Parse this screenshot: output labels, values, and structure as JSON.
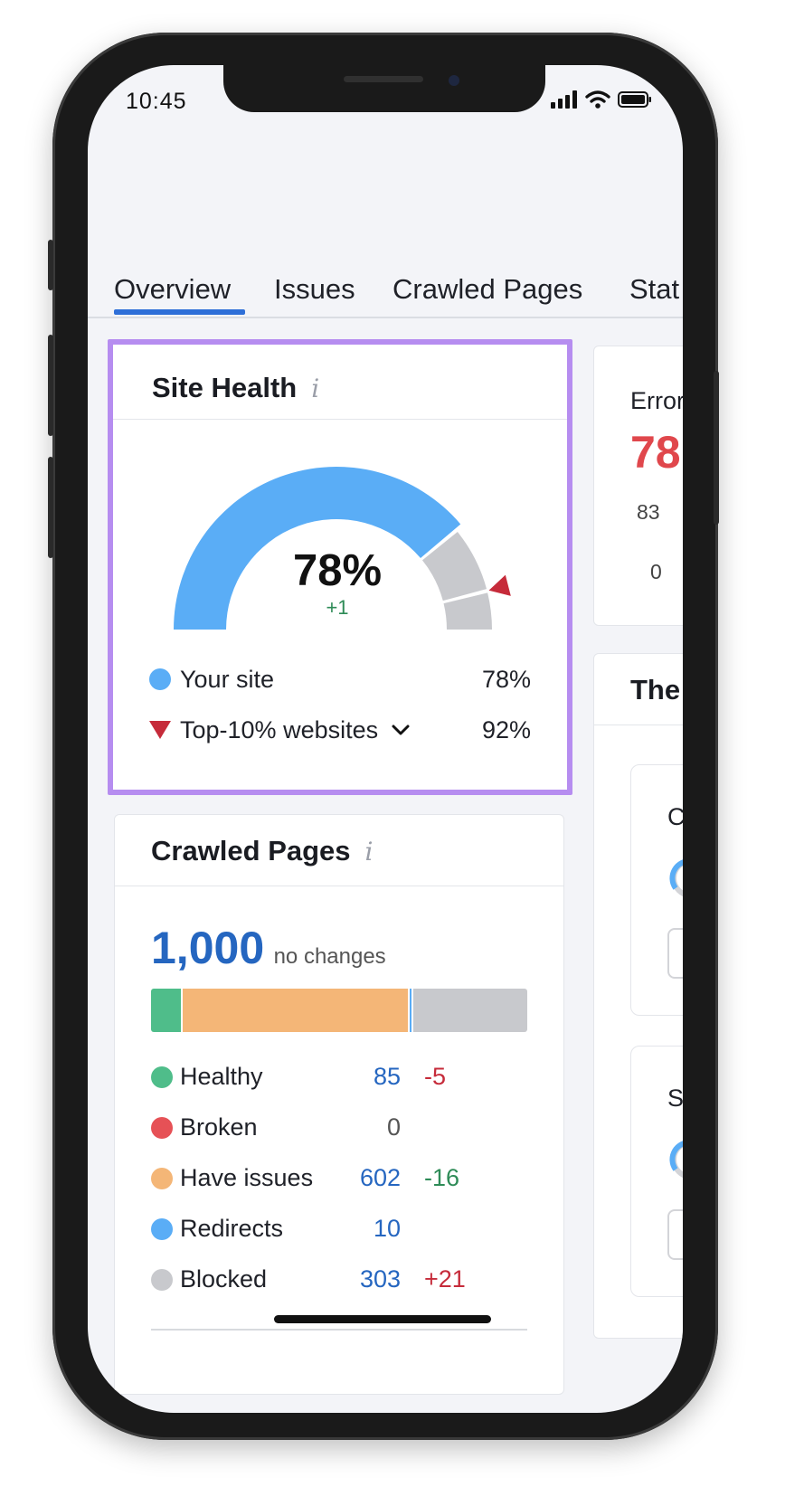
{
  "status_bar": {
    "time": "10:45"
  },
  "tabs": [
    {
      "label": "Overview"
    },
    {
      "label": "Issues"
    },
    {
      "label": "Crawled Pages"
    },
    {
      "label": "Stat"
    }
  ],
  "site_health": {
    "title": "Site Health",
    "info": "i",
    "score": "78%",
    "change": "+1",
    "your_site_fraction": 0.78,
    "top10_fraction": 0.92,
    "legend": [
      {
        "label": "Your site",
        "value": "78%"
      },
      {
        "label": "Top-10% websites",
        "value": "92%"
      }
    ],
    "colors": {
      "your_site": "#5aadf6",
      "remaining": "#c8c9cd",
      "marker": "#c62b3a",
      "highlight": "#b68df0"
    }
  },
  "errors_card": {
    "label": "Error",
    "value": "78",
    "row1": "83",
    "row2": "0"
  },
  "themes_card": {
    "title": "The"
  },
  "right_sub_cards": [
    {
      "label": "C"
    },
    {
      "label": "S"
    }
  ],
  "crawled_pages": {
    "title": "Crawled Pages",
    "info": "i",
    "total": "1,000",
    "total_note": "no changes",
    "bar_fractions": [
      {
        "key": "healthy",
        "fraction": 0.085
      },
      {
        "key": "have_issues",
        "fraction": 0.602
      },
      {
        "key": "redirects",
        "fraction": 0.01
      },
      {
        "key": "blocked",
        "fraction": 0.303
      }
    ],
    "rows": [
      {
        "label": "Healthy",
        "value": "85",
        "delta": "-5",
        "color": "#4fbd8a",
        "delta_color": "#c62b3a"
      },
      {
        "label": "Broken",
        "value": "0",
        "delta": "",
        "color": "#e65156",
        "delta_color": "#1f2128"
      },
      {
        "label": "Have issues",
        "value": "602",
        "delta": "-16",
        "color": "#f4b677",
        "delta_color": "#2e8b57"
      },
      {
        "label": "Redirects",
        "value": "10",
        "delta": "",
        "color": "#5aadf6",
        "delta_color": "#1f2128"
      },
      {
        "label": "Blocked",
        "value": "303",
        "delta": "+21",
        "color": "#c8c9cd",
        "delta_color": "#c62b3a"
      }
    ],
    "colors": {
      "healthy": "#4fbd8a",
      "have_issues": "#f4b677",
      "redirects": "#5aadf6",
      "blocked": "#c8c9cd",
      "total": "#2566c0"
    }
  }
}
